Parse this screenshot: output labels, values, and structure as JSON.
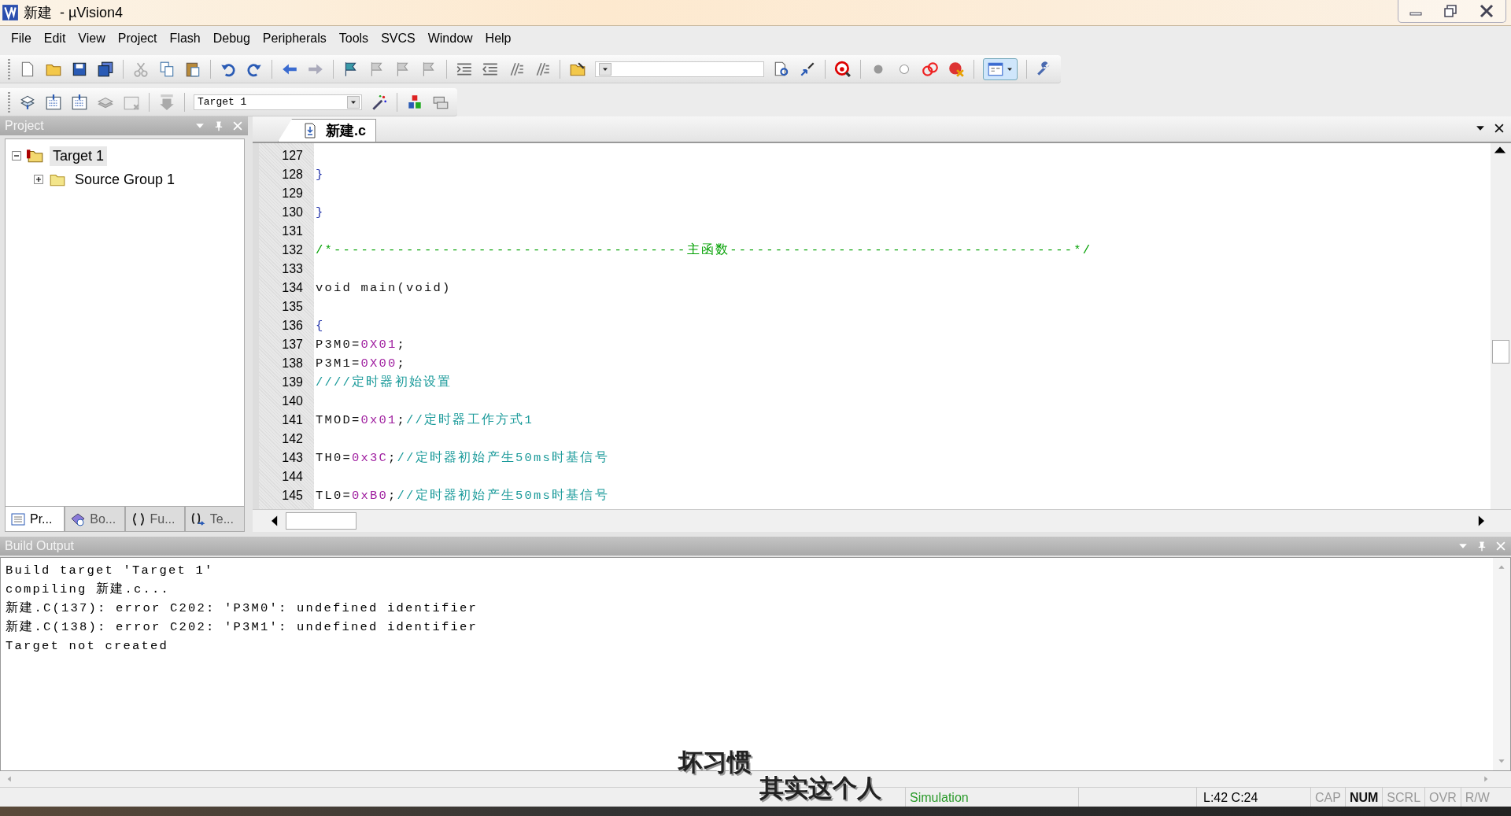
{
  "window": {
    "title": "新建  - µVision4"
  },
  "menu": [
    "File",
    "Edit",
    "View",
    "Project",
    "Flash",
    "Debug",
    "Peripherals",
    "Tools",
    "SVCS",
    "Window",
    "Help"
  ],
  "toolbar": {
    "target_select": {
      "value": "Target 1"
    }
  },
  "project_panel": {
    "title": "Project",
    "tree": [
      {
        "label": "Target 1",
        "expanded": true,
        "selected": true,
        "children": [
          {
            "label": "Source Group 1",
            "expanded": false,
            "selected": false
          }
        ]
      }
    ],
    "tabs": [
      {
        "label": "Pr...",
        "selected": true
      },
      {
        "label": "Bo...",
        "selected": false
      },
      {
        "label": "Fu...",
        "selected": false
      },
      {
        "label": "Te...",
        "selected": false
      }
    ]
  },
  "editor": {
    "tabs": [
      {
        "label": "新建.c",
        "selected": true
      }
    ],
    "lines": [
      {
        "number": "127"
      },
      {
        "number": "128",
        "segments": [
          {
            "kind": "brace",
            "text": "}"
          }
        ]
      },
      {
        "number": "129"
      },
      {
        "number": "130",
        "segments": [
          {
            "kind": "brace",
            "text": "}"
          }
        ]
      },
      {
        "number": "131"
      },
      {
        "number": "132",
        "segments": [
          {
            "kind": "block-comment",
            "text": "/*---------------------------------------主函数--------------------------------------*/"
          }
        ]
      },
      {
        "number": "133"
      },
      {
        "number": "134",
        "segments": [
          {
            "kind": "code",
            "text": "void main(void)"
          }
        ]
      },
      {
        "number": "135"
      },
      {
        "number": "136",
        "segments": [
          {
            "kind": "brace",
            "text": "{"
          }
        ]
      },
      {
        "number": "137",
        "segments": [
          {
            "kind": "code",
            "text": "P3M0="
          },
          {
            "kind": "number",
            "text": "0X01"
          },
          {
            "kind": "code",
            "text": ";"
          }
        ]
      },
      {
        "number": "138",
        "segments": [
          {
            "kind": "code",
            "text": "P3M1="
          },
          {
            "kind": "number",
            "text": "0X00"
          },
          {
            "kind": "code",
            "text": ";"
          }
        ]
      },
      {
        "number": "139",
        "segments": [
          {
            "kind": "comment",
            "text": "////定时器初始设置"
          }
        ]
      },
      {
        "number": "140"
      },
      {
        "number": "141",
        "segments": [
          {
            "kind": "code",
            "text": "TMOD="
          },
          {
            "kind": "number",
            "text": "0x01"
          },
          {
            "kind": "code",
            "text": ";"
          },
          {
            "kind": "comment",
            "text": "//定时器工作方式1"
          }
        ]
      },
      {
        "number": "142"
      },
      {
        "number": "143",
        "segments": [
          {
            "kind": "code",
            "text": "TH0="
          },
          {
            "kind": "number",
            "text": "0x3C"
          },
          {
            "kind": "code",
            "text": ";"
          },
          {
            "kind": "comment",
            "text": "//定时器初始产生50ms时基信号"
          }
        ]
      },
      {
        "number": "144"
      },
      {
        "number": "145",
        "segments": [
          {
            "kind": "code",
            "text": "TL0="
          },
          {
            "kind": "number",
            "text": "0xB0"
          },
          {
            "kind": "code",
            "text": ";"
          },
          {
            "kind": "comment",
            "text": "//定时器初始产生50ms时基信号"
          }
        ]
      }
    ]
  },
  "build_output": {
    "title": "Build Output",
    "lines": [
      "Build target 'Target 1'",
      "compiling 新建.c...",
      "新建.C(137): error C202: 'P3M0': undefined identifier",
      "新建.C(138): error C202: 'P3M1': undefined identifier",
      "Target not created"
    ]
  },
  "status_bar": {
    "mode": "Simulation",
    "position": "L:42 C:24",
    "indicators": [
      {
        "label": "CAP",
        "on": false
      },
      {
        "label": "NUM",
        "on": true
      },
      {
        "label": "SCRL",
        "on": false
      },
      {
        "label": "OVR",
        "on": false
      },
      {
        "label": "R/W",
        "on": false
      }
    ]
  },
  "captions": [
    "坏习惯",
    "其实这个人"
  ]
}
